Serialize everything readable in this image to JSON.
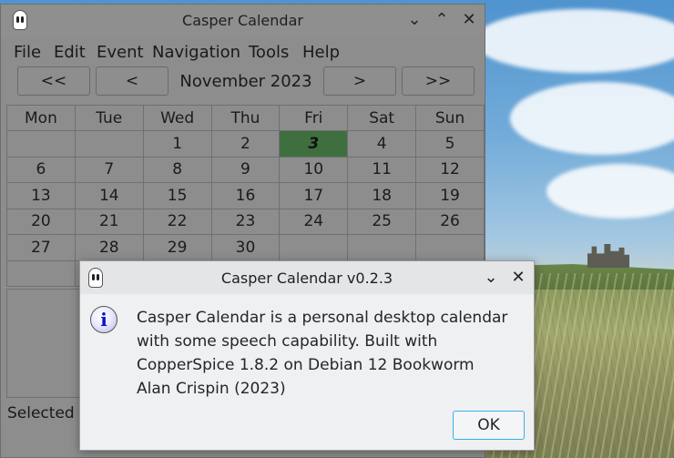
{
  "main_window": {
    "title": "Casper Calendar",
    "menu": [
      "File",
      "Edit",
      "Event",
      "Navigation",
      "Tools",
      "Help"
    ],
    "nav": {
      "prev_year": "<<",
      "prev_month": "<",
      "month_label": "November 2023",
      "next_month": ">",
      "next_year": ">>"
    },
    "weekdays": [
      "Mon",
      "Tue",
      "Wed",
      "Thu",
      "Fri",
      "Sat",
      "Sun"
    ],
    "weeks": [
      [
        "",
        "",
        "1",
        "2",
        "3",
        "4",
        "5"
      ],
      [
        "6",
        "7",
        "8",
        "9",
        "10",
        "11",
        "12"
      ],
      [
        "13",
        "14",
        "15",
        "16",
        "17",
        "18",
        "19"
      ],
      [
        "20",
        "21",
        "22",
        "23",
        "24",
        "25",
        "26"
      ],
      [
        "27",
        "28",
        "29",
        "30",
        "",
        "",
        ""
      ],
      [
        "",
        "",
        "",
        "",
        "",
        "",
        ""
      ]
    ],
    "today": "3",
    "today_color": "#3f6f3f",
    "status": "Selected I"
  },
  "dialog": {
    "title": "Casper Calendar v0.2.3",
    "icon": "info-icon",
    "icon_glyph": "i",
    "message": "Casper Calendar is a personal desktop calendar\nwith some speech capability. Built with\nCopperSpice 1.8.2 on Debian 12 Bookworm\nAlan Crispin (2023)",
    "ok_label": "OK",
    "accent": "#3daee9"
  }
}
